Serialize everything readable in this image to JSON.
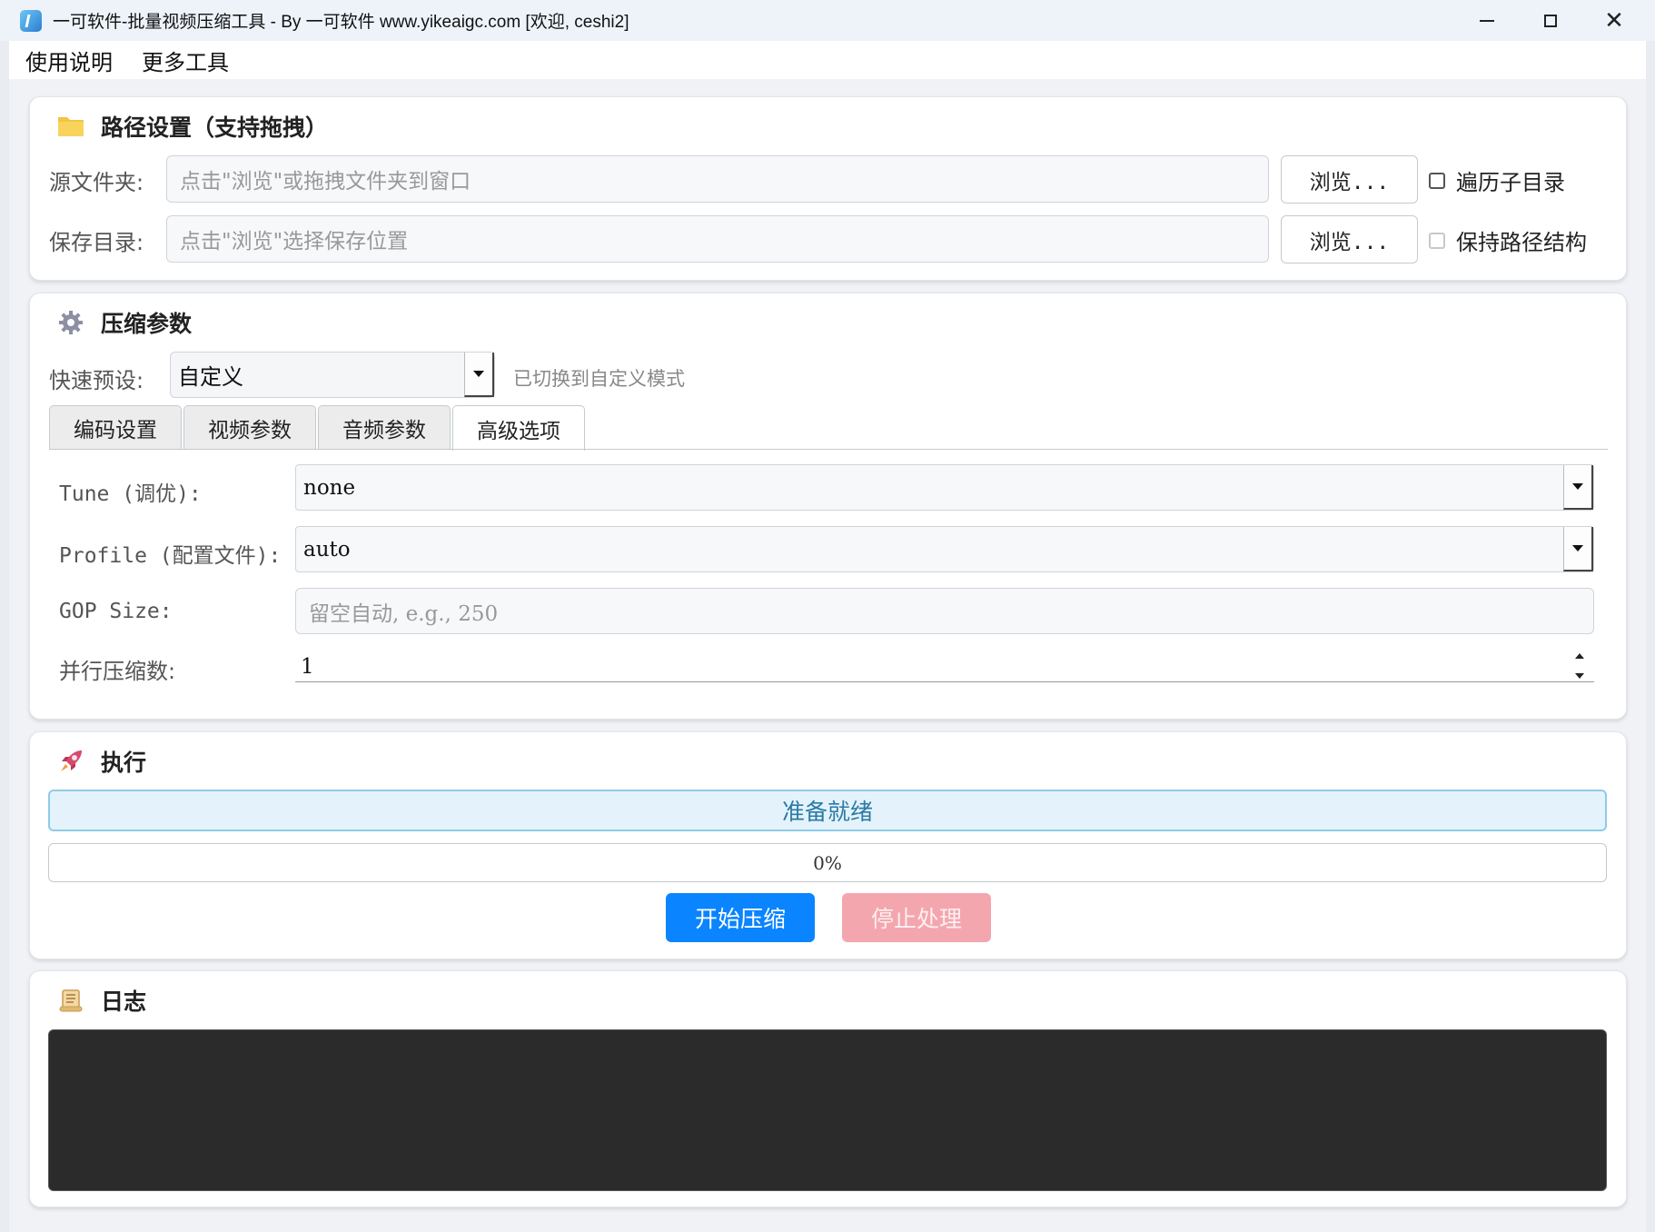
{
  "window": {
    "title": "一可软件-批量视频压缩工具 - By 一可软件 www.yikeaigc.com [欢迎, ceshi2]",
    "close_glyph": "✕"
  },
  "menu": [
    "使用说明",
    "更多工具"
  ],
  "path_section": {
    "title": "路径设置（支持拖拽）",
    "source_label": "源文件夹:",
    "source_placeholder": "点击\"浏览\"或拖拽文件夹到窗口",
    "save_label": "保存目录:",
    "save_placeholder": "点击\"浏览\"选择保存位置",
    "browse_label": "浏览...",
    "recurse_label": "遍历子目录",
    "recurse_checked": false,
    "keep_structure_label": "保持路径结构",
    "keep_structure_checked": false
  },
  "compress_section": {
    "title": "压缩参数",
    "preset_label": "快速预设:",
    "preset_value": "自定义",
    "preset_hint": "已切换到自定义模式",
    "tabs": [
      "编码设置",
      "视频参数",
      "音频参数",
      "高级选项"
    ],
    "active_tab": "高级选项",
    "tune_label": "Tune (调优):",
    "tune_value": "none",
    "profile_label": "Profile (配置文件):",
    "profile_value": "auto",
    "gop_label": "GOP Size:",
    "gop_placeholder": "留空自动, e.g., 250",
    "parallel_label": "并行压缩数:",
    "parallel_value": "1"
  },
  "execute_section": {
    "title": "执行",
    "status_text": "准备就绪",
    "progress_percent": 0,
    "progress_text": "0%",
    "start_label": "开始压缩",
    "stop_label": "停止处理"
  },
  "log_section": {
    "title": "日志"
  },
  "colors": {
    "primary": "#0a84ff",
    "stop_disabled": "#f4a6ae",
    "status_bg": "#e4f3fb",
    "status_border": "#8ecbe8",
    "status_text": "#2b7aa6",
    "log_bg": "#2b2b2b",
    "folder_icon": "#f6c342"
  }
}
